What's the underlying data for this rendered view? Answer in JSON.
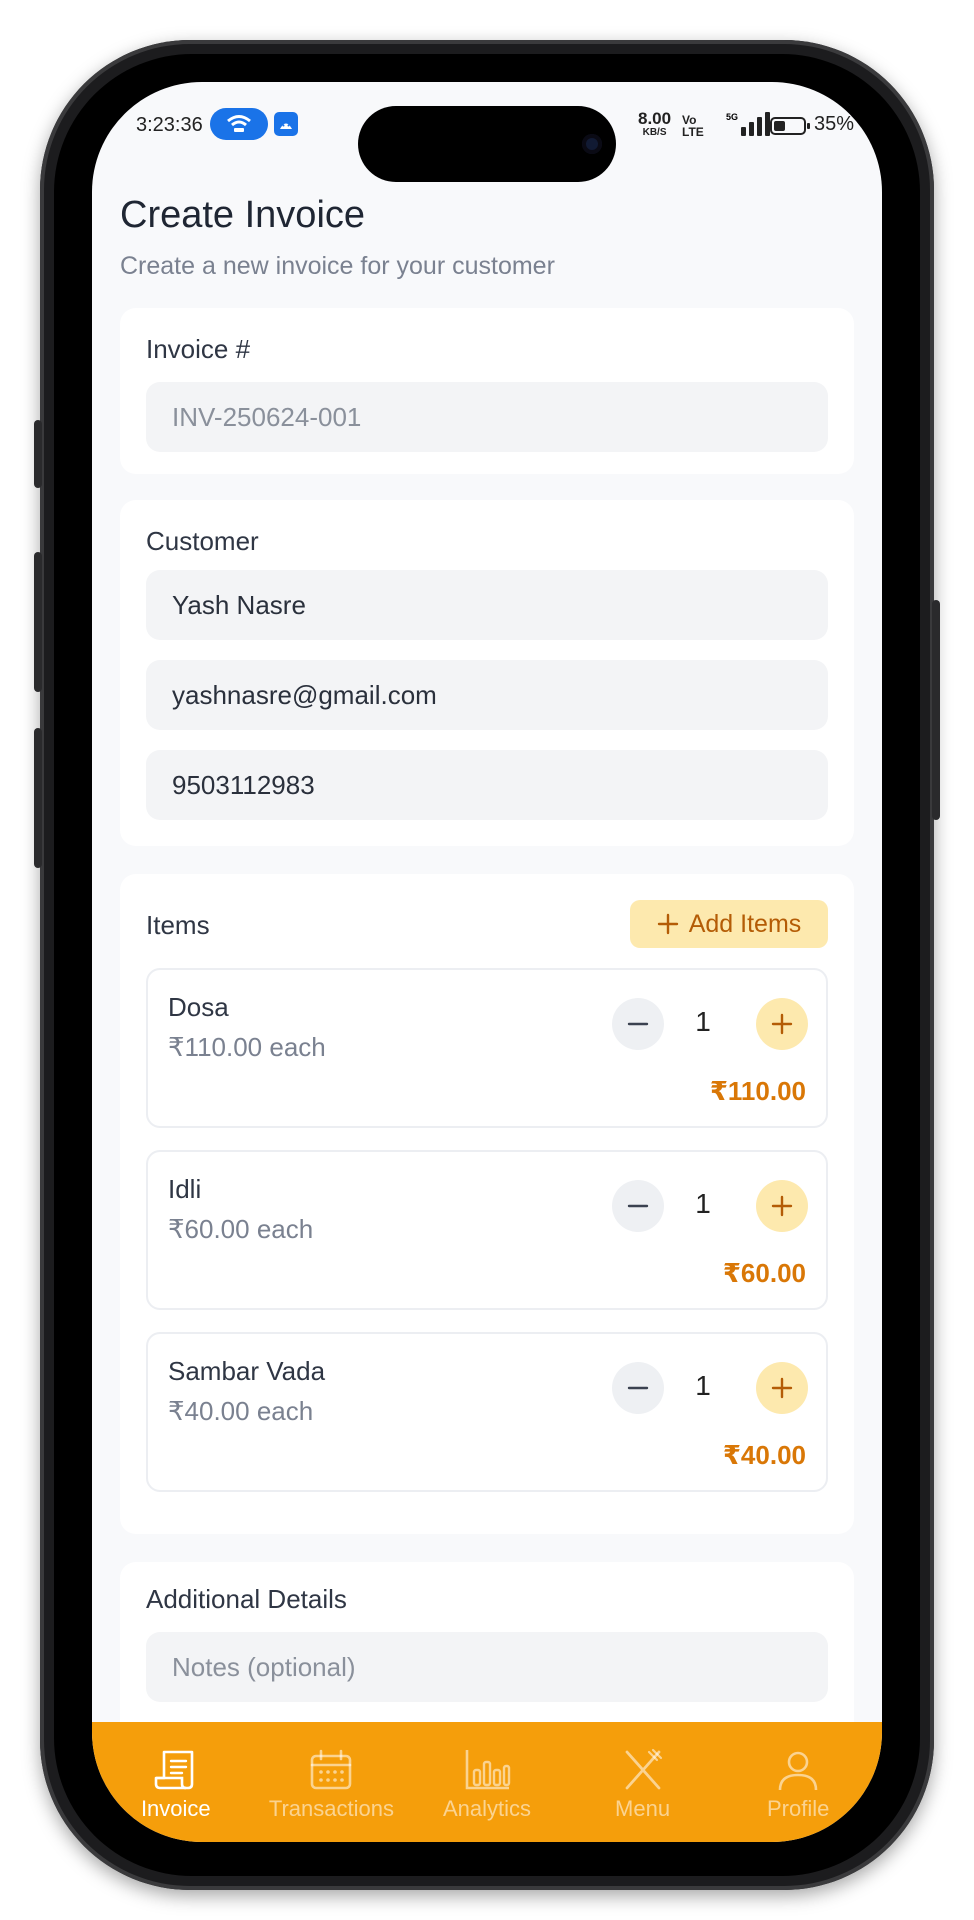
{
  "status_bar": {
    "time": "3:23:36",
    "net_speed": "8.00",
    "net_unit": "KB/S",
    "volte_top": "Vo",
    "volte_bottom": "LTE",
    "network_type": "5G",
    "battery": "35%"
  },
  "header": {
    "title": "Create Invoice",
    "subtitle": "Create a new invoice for your customer"
  },
  "invoice": {
    "label": "Invoice #",
    "number_placeholder": "INV-250624-001"
  },
  "customer": {
    "label": "Customer",
    "name": "Yash Nasre",
    "email": "yashnasre@gmail.com",
    "phone": "9503112983"
  },
  "items_section": {
    "label": "Items",
    "add_button": "Add Items",
    "items": [
      {
        "name": "Dosa",
        "price_each": "₹110.00 each",
        "qty": "1",
        "total": "₹110.00"
      },
      {
        "name": "Idli",
        "price_each": "₹60.00 each",
        "qty": "1",
        "total": "₹60.00"
      },
      {
        "name": "Sambar Vada",
        "price_each": "₹40.00 each",
        "qty": "1",
        "total": "₹40.00"
      }
    ]
  },
  "additional": {
    "label": "Additional Details",
    "notes_placeholder": "Notes (optional)"
  },
  "nav": {
    "items": [
      {
        "label": "Invoice",
        "icon": "invoice-icon",
        "active": true
      },
      {
        "label": "Transactions",
        "icon": "calendar-icon",
        "active": false
      },
      {
        "label": "Analytics",
        "icon": "bar-chart-icon",
        "active": false
      },
      {
        "label": "Menu",
        "icon": "utensils-icon",
        "active": false
      },
      {
        "label": "Profile",
        "icon": "user-icon",
        "active": false
      }
    ]
  },
  "colors": {
    "accent": "#f59e0b",
    "accent_soft": "#fde9ae",
    "price_text": "#d97706",
    "background": "#f8f9fb"
  }
}
